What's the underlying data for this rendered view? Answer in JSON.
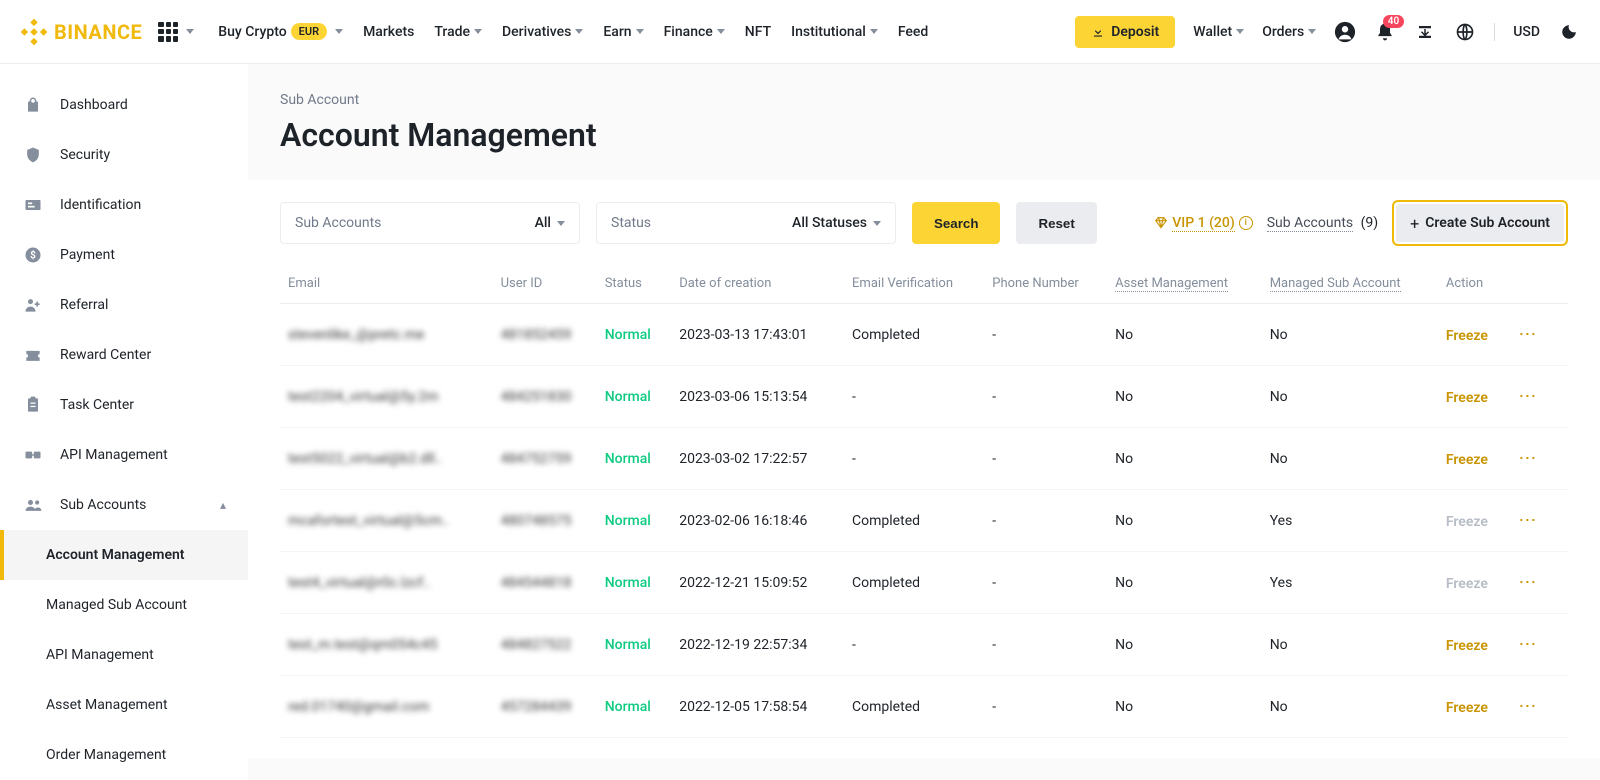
{
  "brand": "BINANCE",
  "topnav": {
    "buy_crypto": "Buy Crypto",
    "eur_badge": "EUR",
    "links": [
      "Markets",
      "Trade",
      "Derivatives",
      "Earn",
      "Finance",
      "NFT",
      "Institutional",
      "Feed"
    ],
    "has_caret": [
      false,
      true,
      true,
      true,
      true,
      false,
      true,
      false
    ],
    "deposit": "Deposit",
    "wallet": "Wallet",
    "orders": "Orders",
    "badge_count": "40",
    "currency": "USD"
  },
  "sidebar": {
    "items": [
      {
        "label": "Dashboard",
        "icon": "dashboard"
      },
      {
        "label": "Security",
        "icon": "shield"
      },
      {
        "label": "Identification",
        "icon": "id"
      },
      {
        "label": "Payment",
        "icon": "dollar"
      },
      {
        "label": "Referral",
        "icon": "referral"
      },
      {
        "label": "Reward Center",
        "icon": "ticket"
      },
      {
        "label": "Task Center",
        "icon": "clipboard"
      },
      {
        "label": "API Management",
        "icon": "api"
      },
      {
        "label": "Sub Accounts",
        "icon": "subaccount",
        "expanded": true
      }
    ],
    "sub_items": [
      "Account Management",
      "Managed Sub Account",
      "API Management",
      "Asset Management",
      "Order Management"
    ],
    "active_sub": 0
  },
  "header": {
    "breadcrumb": "Sub Account",
    "title": "Account Management"
  },
  "filters": {
    "filter1_label": "Sub Accounts",
    "filter1_value": "All",
    "filter2_label": "Status",
    "filter2_value": "All Statuses",
    "search_btn": "Search",
    "reset_btn": "Reset",
    "vip_text": "VIP 1 (20)",
    "sub_count_label": "Sub Accounts",
    "sub_count_value": "(9)",
    "create_btn": "Create Sub Account"
  },
  "table": {
    "headers": [
      "Email",
      "User ID",
      "Status",
      "Date of creation",
      "Email Verification",
      "Phone Number",
      "Asset Management",
      "Managed Sub Account",
      "Action"
    ],
    "rows": [
      {
        "email": "stevenlike_@pretc.me",
        "userid": "481852459",
        "status": "Normal",
        "date": "2023-03-13 17:43:01",
        "email_verif": "Completed",
        "phone": "-",
        "asset": "No",
        "managed": "No",
        "freeze_active": true
      },
      {
        "email": "test2204_virtual@5y.2m",
        "userid": "484251830",
        "status": "Normal",
        "date": "2023-03-06 15:13:54",
        "email_verif": "-",
        "phone": "-",
        "asset": "No",
        "managed": "No",
        "freeze_active": true
      },
      {
        "email": "test5022_virtual@b2.dll..",
        "userid": "484752759",
        "status": "Normal",
        "date": "2023-03-02 17:22:57",
        "email_verif": "-",
        "phone": "-",
        "asset": "No",
        "managed": "No",
        "freeze_active": true
      },
      {
        "email": "mcafortest_virtual@5cm..",
        "userid": "480748575",
        "status": "Normal",
        "date": "2023-02-06 16:18:46",
        "email_verif": "Completed",
        "phone": "-",
        "asset": "No",
        "managed": "Yes",
        "freeze_active": false
      },
      {
        "email": "test4_virtual@r0c.lzcf..",
        "userid": "484544818",
        "status": "Normal",
        "date": "2022-12-21 15:09:52",
        "email_verif": "Completed",
        "phone": "-",
        "asset": "No",
        "managed": "Yes",
        "freeze_active": false
      },
      {
        "email": "test_m.test@qm054c45",
        "userid": "484827522",
        "status": "Normal",
        "date": "2022-12-19 22:57:34",
        "email_verif": "-",
        "phone": "-",
        "asset": "No",
        "managed": "No",
        "freeze_active": true
      },
      {
        "email": "red.01740@gmail.com",
        "userid": "457284439",
        "status": "Normal",
        "date": "2022-12-05 17:58:54",
        "email_verif": "Completed",
        "phone": "-",
        "asset": "No",
        "managed": "No",
        "freeze_active": true
      }
    ],
    "freeze_label": "Freeze"
  }
}
